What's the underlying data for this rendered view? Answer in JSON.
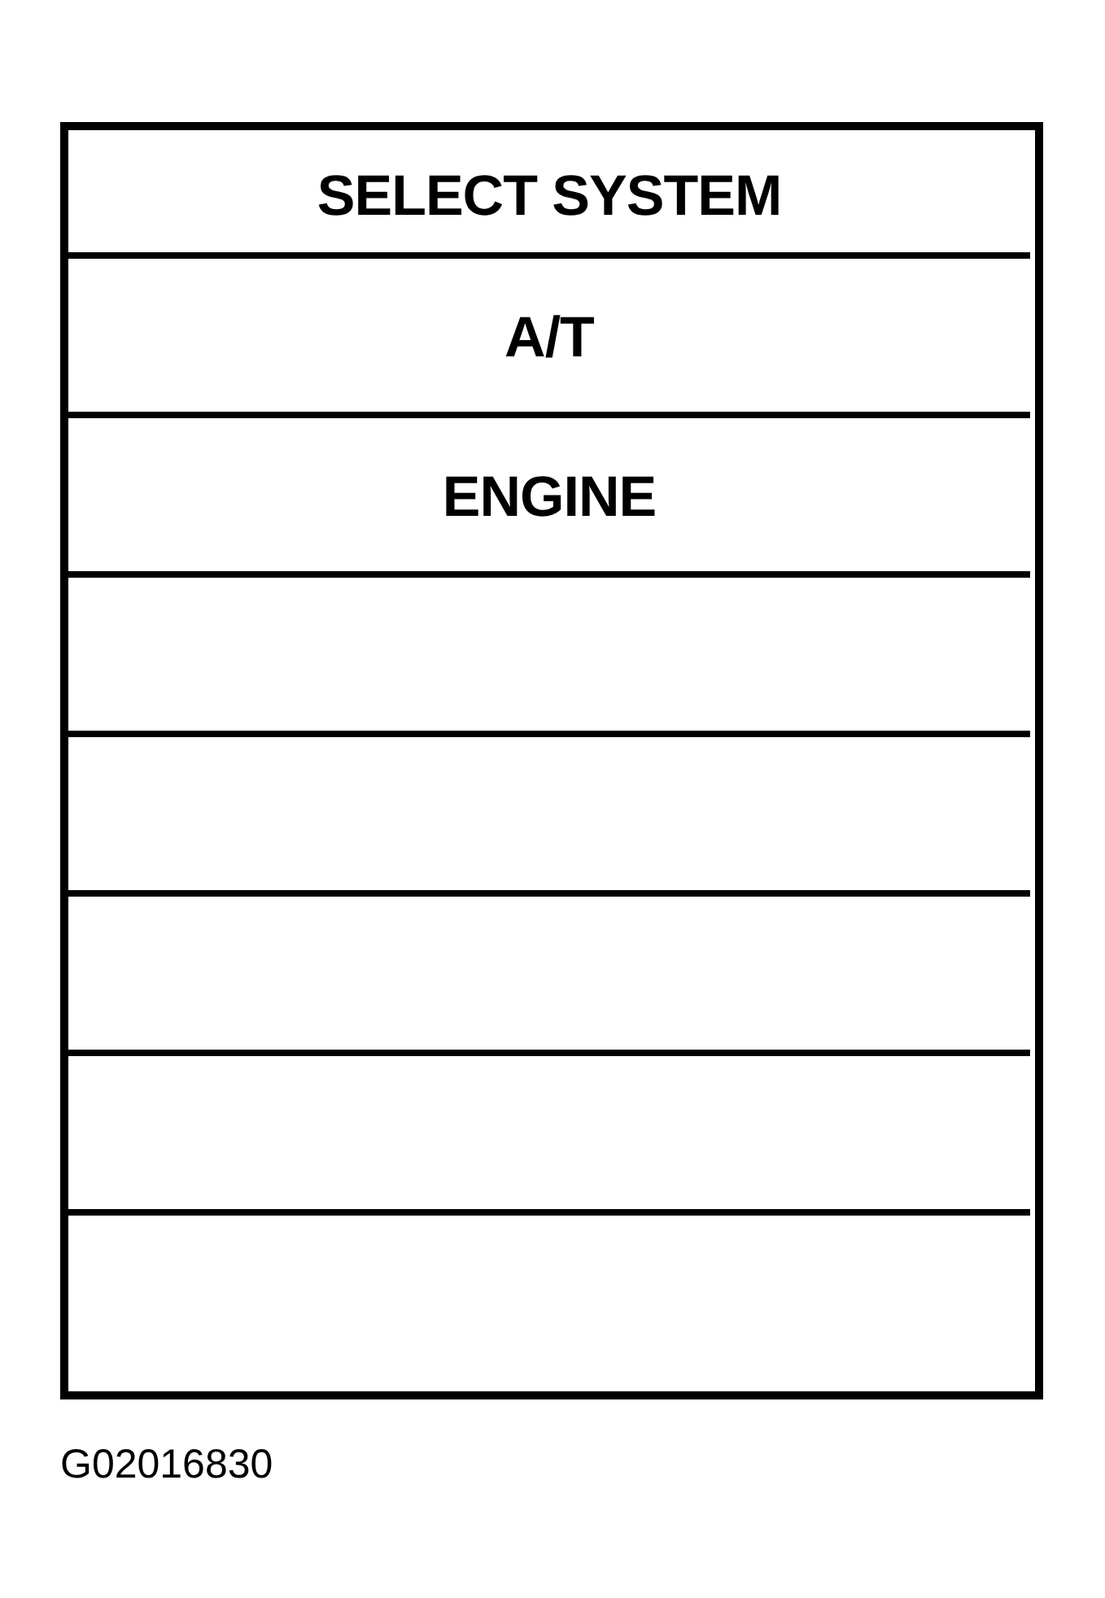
{
  "menu": {
    "title": "SELECT SYSTEM",
    "items": [
      {
        "label": "A/T"
      },
      {
        "label": "ENGINE"
      }
    ]
  },
  "caption": "G02016830"
}
